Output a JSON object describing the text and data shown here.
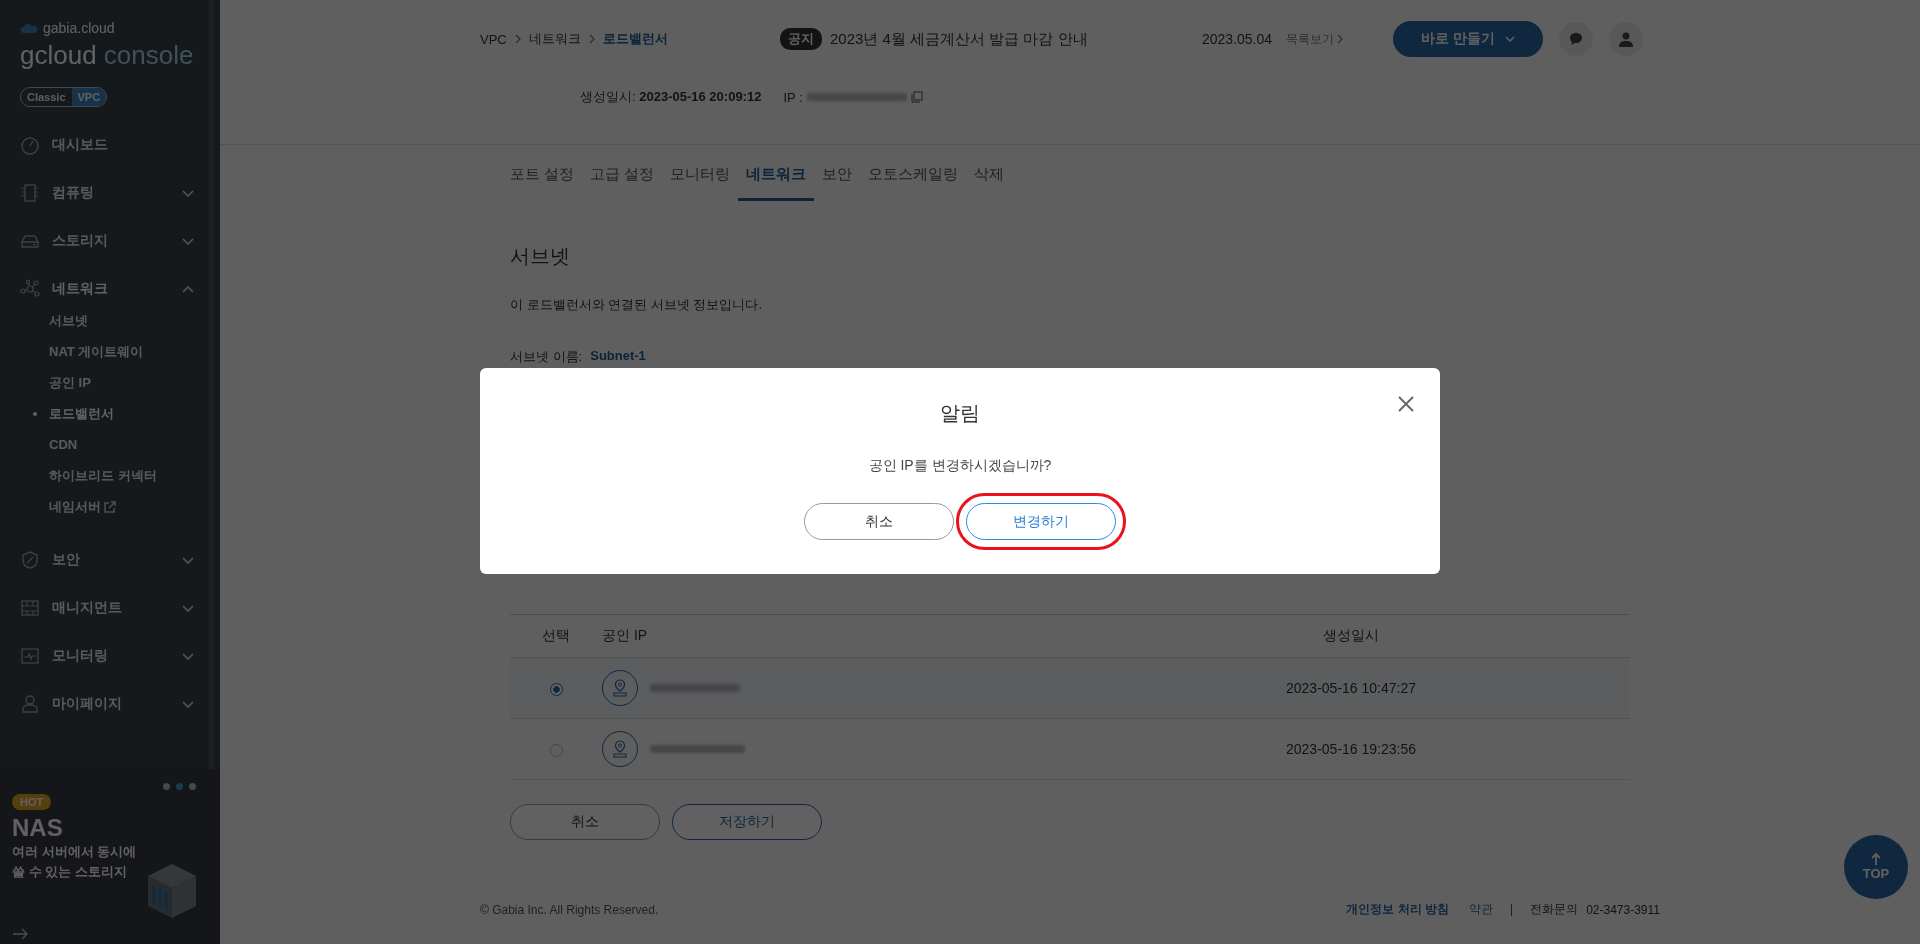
{
  "sidebar": {
    "brand": "gabia.cloud",
    "product_main": "gcloud",
    "product_sub": "console",
    "modes": [
      {
        "label": "Classic",
        "selected": false
      },
      {
        "label": "VPC",
        "selected": true
      }
    ],
    "menu": [
      {
        "label": "대시보드",
        "expandable": false
      },
      {
        "label": "컴퓨팅",
        "expandable": true,
        "expanded": false
      },
      {
        "label": "스토리지",
        "expandable": true,
        "expanded": false
      },
      {
        "label": "네트워크",
        "expandable": true,
        "expanded": true,
        "children": [
          {
            "label": "서브넷",
            "selected": false,
            "external": false
          },
          {
            "label": "NAT 게이트웨이",
            "selected": false,
            "external": false
          },
          {
            "label": "공인 IP",
            "selected": false,
            "external": false
          },
          {
            "label": "로드밸런서",
            "selected": true,
            "external": false
          },
          {
            "label": "CDN",
            "selected": false,
            "external": false
          },
          {
            "label": "하이브리드 커넥터",
            "selected": false,
            "external": false
          },
          {
            "label": "네임서버",
            "selected": false,
            "external": true
          }
        ]
      },
      {
        "label": "보안",
        "expandable": true,
        "expanded": false
      },
      {
        "label": "매니지먼트",
        "expandable": true,
        "expanded": false
      },
      {
        "label": "모니터링",
        "expandable": true,
        "expanded": false
      },
      {
        "label": "마이페이지",
        "expandable": true,
        "expanded": false
      }
    ],
    "promo": {
      "badge": "HOT",
      "title": "NAS",
      "lines": [
        "여러 서버에서 동시에",
        "쓸 수 있는 스토리지"
      ],
      "pager": [
        {
          "selected": false
        },
        {
          "selected": true
        },
        {
          "selected": false
        }
      ]
    }
  },
  "header": {
    "breadcrumb": [
      {
        "label": "VPC",
        "selected": false
      },
      {
        "label": "네트워크",
        "selected": false
      },
      {
        "label": "로드밸런서",
        "selected": true
      }
    ],
    "notice": {
      "badge": "공지",
      "text": "2023년 4월 세금계산서 발급 마감 안내",
      "date": "2023.05.04",
      "more": "목록보기"
    },
    "create_button": "바로 만들기"
  },
  "info": {
    "created_label": "생성일시:",
    "created_value": "2023-05-16 20:09:12",
    "ip_label": "IP :"
  },
  "tabs": [
    {
      "label": "포트 설정",
      "selected": false
    },
    {
      "label": "고급 설정",
      "selected": false
    },
    {
      "label": "모니터링",
      "selected": false
    },
    {
      "label": "네트워크",
      "selected": true
    },
    {
      "label": "보안",
      "selected": false
    },
    {
      "label": "오토스케일링",
      "selected": false
    },
    {
      "label": "삭제",
      "selected": false
    }
  ],
  "subnet": {
    "heading": "서브넷",
    "description": "이 로드밸런서와 연결된 서브넷 정보입니다.",
    "name_label": "서브넷 이름:",
    "name_value": "Subnet-1"
  },
  "table": {
    "columns": [
      "선택",
      "공인 IP",
      "생성일시"
    ],
    "rows": [
      {
        "selected": true,
        "created": "2023-05-16 10:47:27"
      },
      {
        "selected": false,
        "created": "2023-05-16 19:23:56"
      }
    ]
  },
  "actions": [
    "취소",
    "저장하기"
  ],
  "footer": {
    "copyright": "© Gabia Inc. All Rights Reserved.",
    "privacy": "개인정보 처리 방침",
    "terms": "약관",
    "phone_label": "전화문의",
    "phone": "02-3473-3911"
  },
  "top_button": "TOP",
  "modal": {
    "title": "알림",
    "message": "공인 IP를 변경하시겠습니까?",
    "buttons": [
      {
        "label": "취소",
        "kind": "secondary",
        "highlighted": false
      },
      {
        "label": "변경하기",
        "kind": "primary",
        "highlighted": true
      }
    ]
  }
}
